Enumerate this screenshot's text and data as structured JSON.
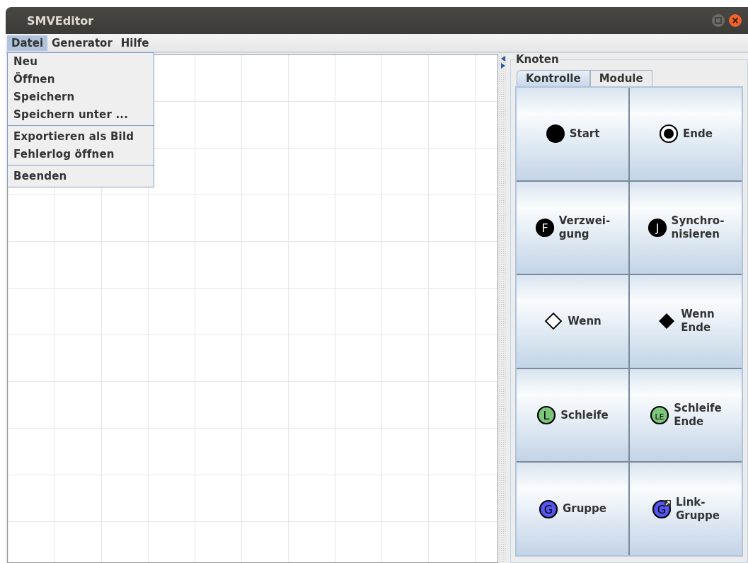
{
  "window": {
    "title": "SMVEditor"
  },
  "menu_bar": [
    {
      "label": "Datei",
      "selected": true
    },
    {
      "label": "Generator",
      "selected": false
    },
    {
      "label": "Hilfe",
      "selected": false
    }
  ],
  "dropdown": {
    "groups": [
      [
        "Neu",
        "Öffnen",
        "Speichern",
        "Speichern unter ..."
      ],
      [
        "Exportieren als Bild",
        "Fehlerlog öffnen"
      ],
      [
        "Beenden"
      ]
    ]
  },
  "panel": {
    "title": "Knoten",
    "tabs": [
      {
        "label": "Kontrolle",
        "selected": true
      },
      {
        "label": "Module",
        "selected": false
      }
    ],
    "buttons": [
      {
        "label": "Start",
        "kind": "dot",
        "color": "#000000"
      },
      {
        "label": "Ende",
        "kind": "ring",
        "color": "#000000"
      },
      {
        "label": "Verzwei-\ngung",
        "kind": "letter",
        "letter": "F",
        "color": "#000000"
      },
      {
        "label": "Synchro-\nnisieren",
        "kind": "letter",
        "letter": "J",
        "color": "#000000"
      },
      {
        "label": "Wenn",
        "kind": "diamond-open",
        "color": "#ffffff"
      },
      {
        "label": "Wenn\nEnde",
        "kind": "diamond",
        "color": "#000000"
      },
      {
        "label": "Schleife",
        "kind": "letter",
        "letter": "L",
        "color": "#7cc67c"
      },
      {
        "label": "Schleife\nEnde",
        "kind": "letter",
        "letter": "LE",
        "color": "#7cc67c"
      },
      {
        "label": "Gruppe",
        "kind": "letter",
        "letter": "G",
        "color": "#5555f0"
      },
      {
        "label": "Link-\nGruppe",
        "kind": "link",
        "letter": "G",
        "color": "#5555f0"
      }
    ]
  }
}
